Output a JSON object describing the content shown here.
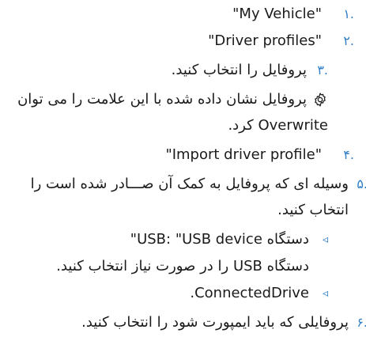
{
  "steps": [
    {
      "num": ".۱",
      "text": "\"My Vehicle\""
    },
    {
      "num": ".۲",
      "text": "\"Driver profiles\""
    },
    {
      "num": ".۳",
      "text": "پروفایل را انتخاب کنید."
    },
    {
      "note_line1": "پروفایل نشان داده شده با این علامت را می توان",
      "note_line2_word": "Overwrite",
      "note_line2_rest": "کرد."
    },
    {
      "num": ".۴",
      "text": "\"Import driver profile\""
    },
    {
      "num": ".۵",
      "line1": "وسیله ای که پروفایل به کمک آن صـــادر شده است را",
      "line2": "انتخاب کنید."
    },
    {
      "sub1_label": "دستگاه USB: \"USB device\"",
      "sub1_desc": "دستگاه USB را در صورت نیاز انتخاب کنید."
    },
    {
      "sub2_label": ".ConnectedDrive"
    },
    {
      "num": ".۶",
      "text": "پروفایلی که باید ایمپورت شود را انتخاب کنید."
    }
  ],
  "colors": {
    "accent": "#2f7fc9",
    "text": "#1a1a1a"
  },
  "icons": {
    "settings": "gear-icon",
    "bullet": "triangle-bullet-icon"
  }
}
